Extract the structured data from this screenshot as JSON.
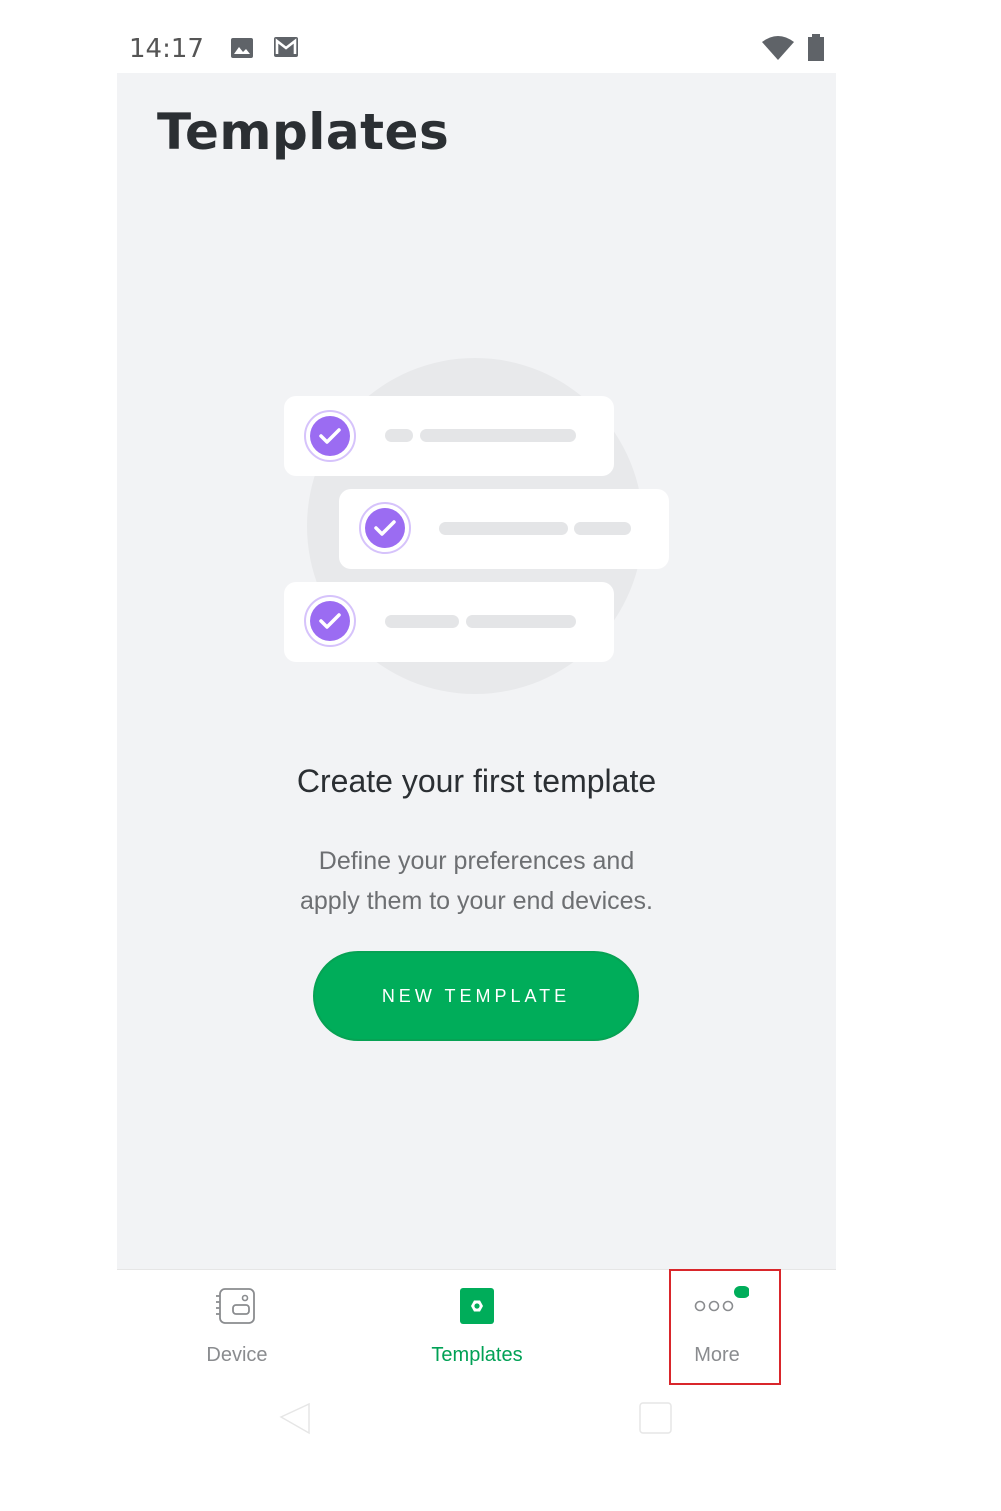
{
  "status_bar": {
    "time": "14:17",
    "left_icons": [
      "image-icon",
      "gmail-icon"
    ],
    "right_icons": [
      "wifi-icon",
      "battery-icon"
    ]
  },
  "header": {
    "title": "Templates"
  },
  "empty_state": {
    "illustration_icons": [
      "check-circle-icon",
      "check-circle-icon",
      "check-circle-icon"
    ],
    "heading": "Create your first template",
    "description_line1": "Define your preferences and",
    "description_line2": "apply them to your end devices.",
    "button_label": "NEW TEMPLATE"
  },
  "bottom_nav": {
    "items": [
      {
        "label": "Device",
        "icon": "device-icon",
        "active": false
      },
      {
        "label": "Templates",
        "icon": "templates-icon",
        "active": true
      },
      {
        "label": "More",
        "icon": "more-dots-icon",
        "active": false,
        "has_notification_dot": true
      }
    ]
  },
  "colors": {
    "accent": "#00ad5a",
    "check_purple": "#9b6cf2",
    "background": "#f2f3f5",
    "inactive_label": "#8a8c8f"
  }
}
